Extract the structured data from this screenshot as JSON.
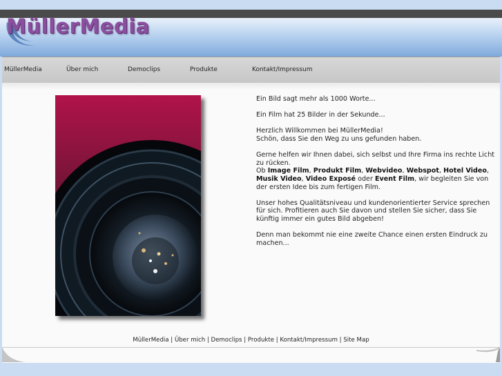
{
  "brand": {
    "name": "MüllerMedia"
  },
  "nav": {
    "items": [
      "MüllerMedia",
      "Über mich",
      "Democlips",
      "Produkte",
      "Kontakt/Impressum"
    ]
  },
  "content": {
    "p1": "Ein Bild sagt mehr als 1000 Worte...",
    "p2": "Ein Film hat 25 Bilder in der Sekunde...",
    "p3a": "Herzlich Willkommen bei MüllerMedia!",
    "p3b": "Schön, dass Sie den Weg zu uns gefunden haben.",
    "p4a": "Gerne helfen wir Ihnen dabei, sich selbst und Ihre Firma ins rechte Licht zu rücken.",
    "p4_intro": "Ob",
    "p4_products": [
      "Image Film",
      "Produkt Film",
      "Webvideo",
      "Webspot",
      "Hotel Video",
      "Musik Video",
      "Video Exposé",
      "Event Film"
    ],
    "p4_sep": ",",
    "p4_or": "oder",
    "p4_outro": ", wir begleiten Sie von der ersten Idee bis zum fertigen Film.",
    "p5": "Unser hohes Qualitätsniveau und kundenorientierter Service sprechen für sich. Profitieren auch Sie davon und stellen Sie sicher, dass Sie künftig immer ein gutes Bild abgeben!",
    "p6": "Denn man bekommt nie eine zweite Chance einen ersten Eindruck zu machen..."
  },
  "footer": {
    "links": [
      "MüllerMedia",
      "Über mich",
      "Democlips",
      "Produkte",
      "Kontakt/Impressum",
      "Site Map"
    ],
    "separator": " | "
  },
  "colors": {
    "page_bg": "#c9dcf2",
    "logo": "#8a4f9e",
    "nav_bg": "#d0d0d0",
    "photo_top": "#b1134a"
  }
}
